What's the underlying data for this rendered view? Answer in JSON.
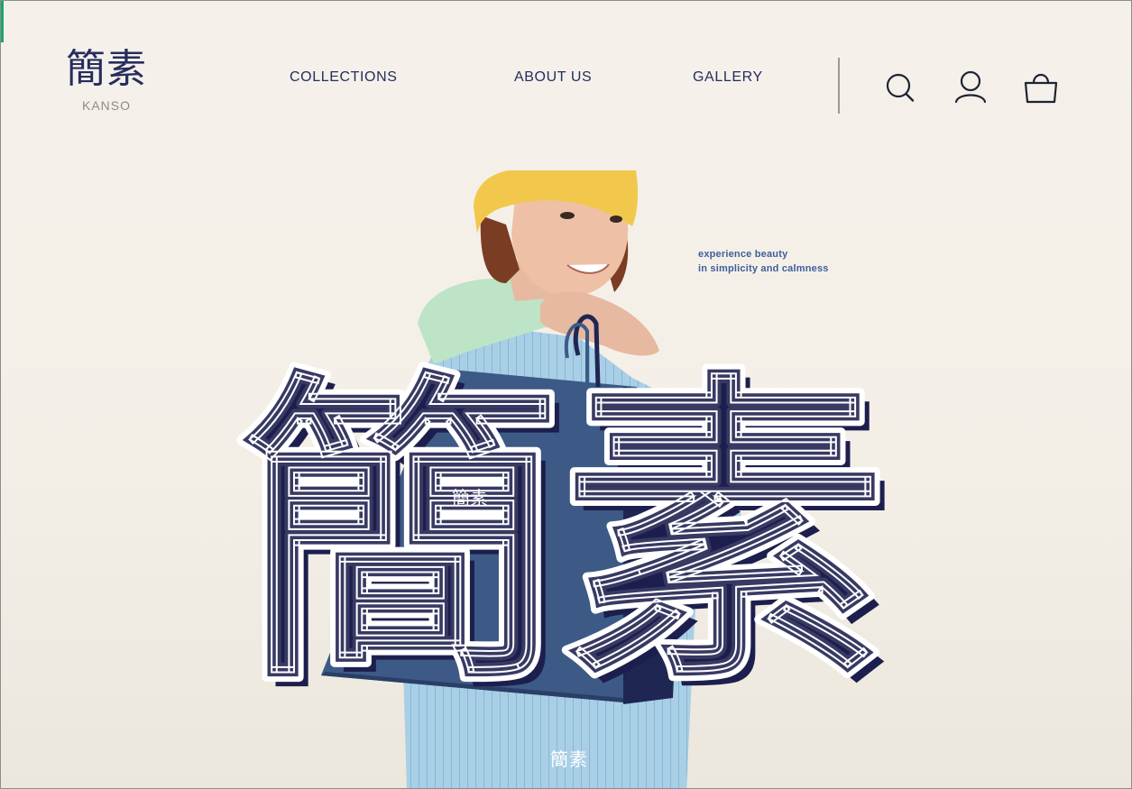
{
  "brand": {
    "kanji": "簡素",
    "romaji": "KANSO"
  },
  "nav": {
    "items": [
      {
        "label": "COLLECTIONS"
      },
      {
        "label": "ABOUT US"
      },
      {
        "label": "GALLERY"
      }
    ]
  },
  "header_icons": [
    "search-icon",
    "user-icon",
    "shopping-bag-icon"
  ],
  "hero": {
    "tagline_line1": "experience beauty",
    "tagline_line2": "in simplicity and calmness",
    "big_kanji": "簡素",
    "bag_kanji": "簡素",
    "bottom_kanji": "簡素"
  },
  "colors": {
    "navy": "#262d5e",
    "bag_blue": "#3d5a86",
    "jacket_blue": "#a9cfe6",
    "beanie_yellow": "#f1c84c",
    "hoodie_mint": "#bde4c6",
    "background": "#f3efe7"
  }
}
